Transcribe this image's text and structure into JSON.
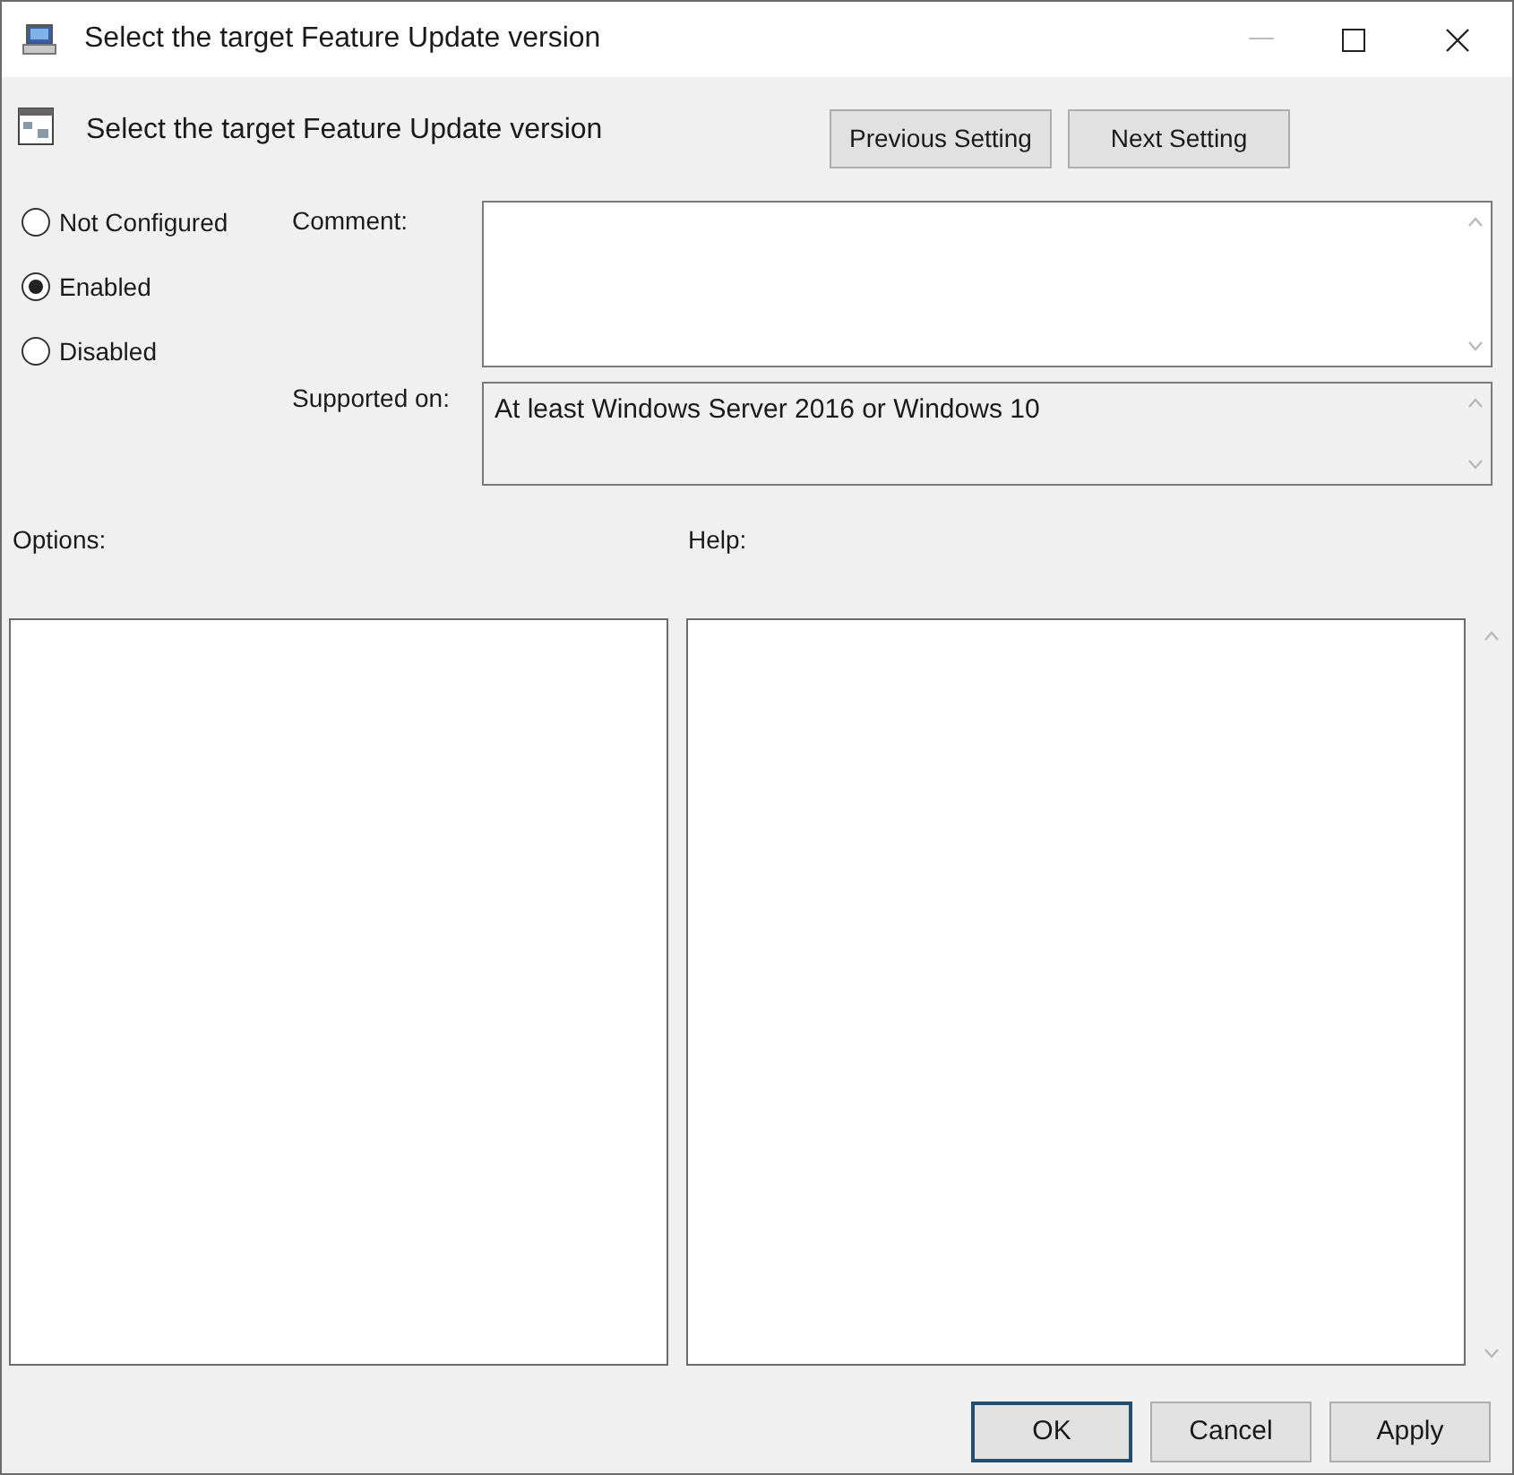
{
  "window": {
    "title": "Select the target Feature Update version"
  },
  "header": {
    "title": "Select the target Feature Update version"
  },
  "nav_buttons": [
    "Previous Setting",
    "Next Setting"
  ],
  "state_options": [
    {
      "label": "Not Configured",
      "selected": false
    },
    {
      "label": "Enabled",
      "selected": true
    },
    {
      "label": "Disabled",
      "selected": false
    }
  ],
  "comment": {
    "label": "Comment:"
  },
  "supported_on": {
    "label": "Supported on:",
    "value": "At least Windows Server 2016 or Windows 10"
  },
  "options": {
    "label": "Options:"
  },
  "help": {
    "label": "Help:"
  },
  "buttons": [
    {
      "label": "OK",
      "default": true
    },
    {
      "label": "Cancel",
      "default": false
    },
    {
      "label": "Apply",
      "default": false
    }
  ]
}
